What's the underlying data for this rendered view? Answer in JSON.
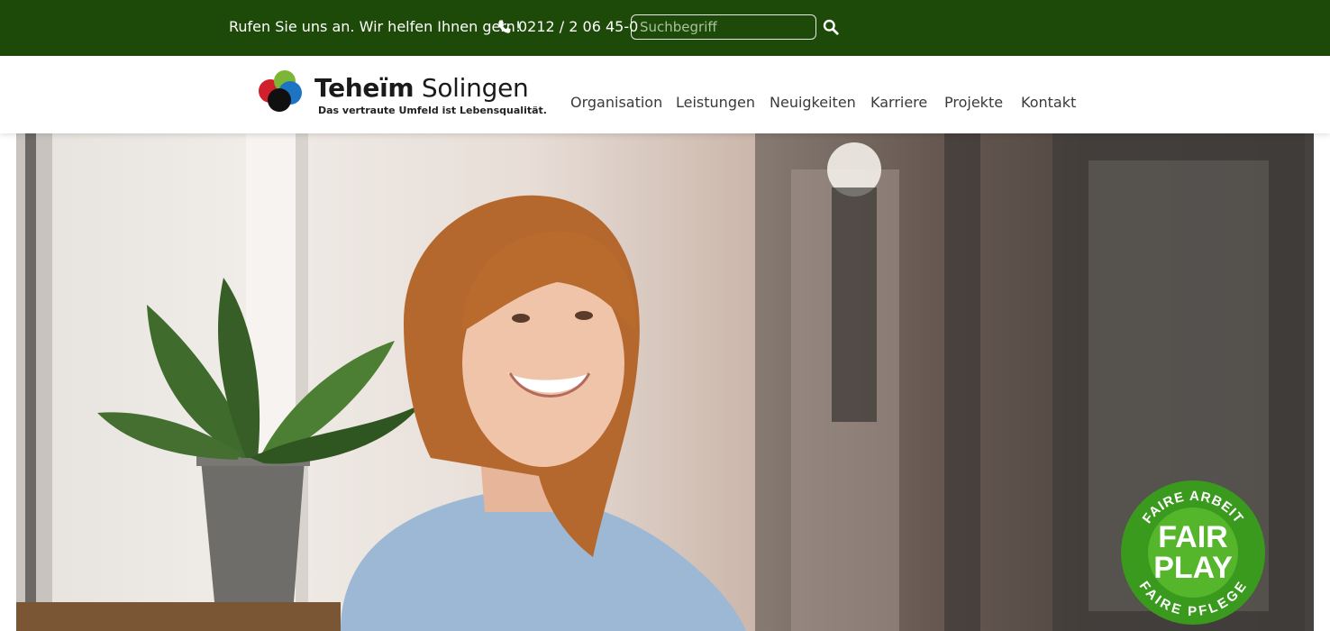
{
  "topbar": {
    "claim": "Rufen Sie uns an. Wir helfen Ihnen gern!",
    "phone": "0212 / 2 06 45-0",
    "search_placeholder": "Suchbegriff"
  },
  "logo": {
    "name_bold": "Teheïm",
    "name_regular": " Solingen",
    "tagline": "Das vertraute Umfeld ist Lebensqualität."
  },
  "nav": {
    "items": [
      {
        "label": "Organisation"
      },
      {
        "label": "Leistungen"
      },
      {
        "label": "Neuigkeiten"
      },
      {
        "label": "Karriere"
      },
      {
        "label": "Projekte"
      },
      {
        "label": "Kontakt"
      }
    ]
  },
  "badge": {
    "top_text": "FAIRE ARBEIT",
    "center_line1": "FAIR",
    "center_line2": "PLAY",
    "bottom_text": "FAIRE PFLEGE"
  },
  "colors": {
    "topbar_bg": "#1d4a08",
    "badge_green": "#3a9a1e"
  },
  "icons": {
    "phone": "phone-icon",
    "search": "search-icon"
  }
}
